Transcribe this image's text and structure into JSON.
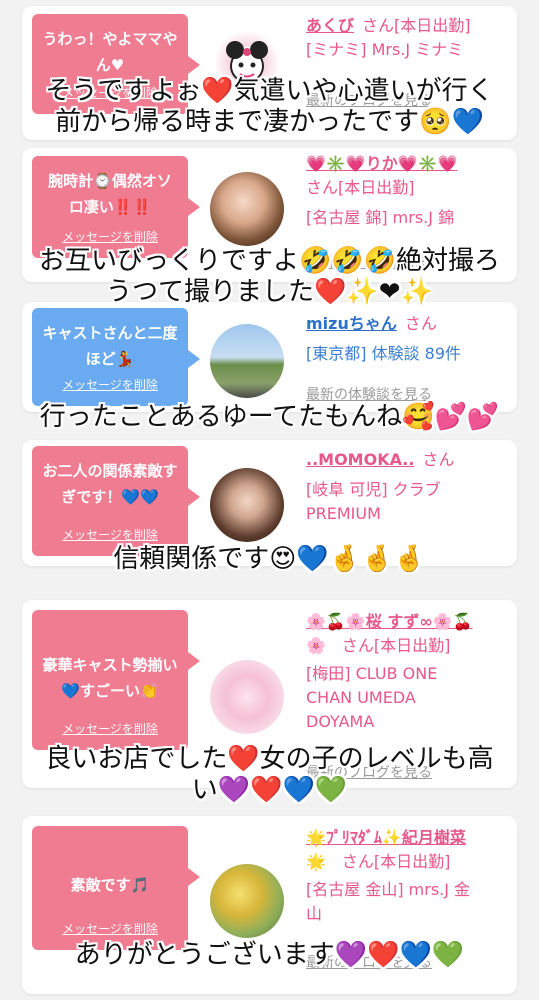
{
  "reviews": [
    {
      "bubble": "うわっ！やよママやん♥",
      "delete_label": "メッセージを削除",
      "name": "あくび",
      "suffix": "さん[本日出勤]",
      "line1": "[ミナミ] Mrs.J ミナミ",
      "line2": "",
      "line3": "",
      "more": "最新のブログを見る"
    },
    {
      "bubble": "腕時計⌚偶然オソロ凄い‼️‼️",
      "delete_label": "メッセージを削除",
      "name": "💗✳️💗りか💗✳️💗",
      "suffix": "さん[本日出勤]",
      "line1": "[名古屋 錦] mrs.J 錦",
      "line2": "",
      "line3": "",
      "more": "最新のブログを見る"
    },
    {
      "bubble": "キャストさんと二度ほど💃",
      "delete_label": "メッセージを削除",
      "name": "mizuちゃん",
      "suffix": "さん",
      "line1": "[東京都] 体験談 89件",
      "line2": "",
      "line3": "",
      "more": "最新の体験談を見る"
    },
    {
      "bubble": "お二人の関係素敵すぎです！💙💙",
      "delete_label": "メッセージを削除",
      "name": "..MOMOKA..",
      "suffix": "さん",
      "line1": "[岐阜 可児] クラブ",
      "line2": "PREMIUM",
      "line3": "",
      "more": "最新のブログを見る"
    },
    {
      "bubble": "豪華キャスト勢揃い💙すごーい👏",
      "delete_label": "メッセージを削除",
      "name": "🌸🍒🌸桜 すず∞🌸🍒",
      "suffix": "🌸　さん[本日出勤]",
      "line1": "[梅田] CLUB ONE",
      "line2": "CHAN UMEDA",
      "line3": "DOYAMA",
      "more": "最新のブログを見る"
    },
    {
      "bubble": "素敵です🎵",
      "delete_label": "メッセージを削除",
      "name": "🌟ﾌﾟﾘﾏﾀﾞﾑ✨紀月樹菜",
      "suffix": "🌟　さん[本日出勤]",
      "line1": "[名古屋 金山] mrs.J 金",
      "line2": "山",
      "line3": "",
      "more": "最新のブログを見る"
    }
  ],
  "captions": [
    {
      "l1": "そうですよぉ❤️気遣いや心遣いが行く",
      "l2": "前から帰る時まで凄かったです🥺💙"
    },
    {
      "l1": "お互いびっくりですよ🤣🤣🤣絶対撮ろ",
      "l2": "うつて撮りました❤️✨❤✨"
    },
    {
      "l1": "行ったことあるゆーてたもんね🥰💕💕",
      "l2": ""
    },
    {
      "l1": "信頼関係です😍💙🤞🤞🤞",
      "l2": ""
    },
    {
      "l1": "良いお店でした❤️女の子のレベルも高",
      "l2": "い💜❤️💙💚"
    },
    {
      "l1": "ありがとうございます💜❤️💙💚",
      "l2": ""
    }
  ],
  "colors": {
    "pink_bubble": "#f07c92",
    "blue_bubble": "#6aaaf0",
    "pink_text": "#e8578a",
    "blue_text": "#3c7fd0"
  }
}
